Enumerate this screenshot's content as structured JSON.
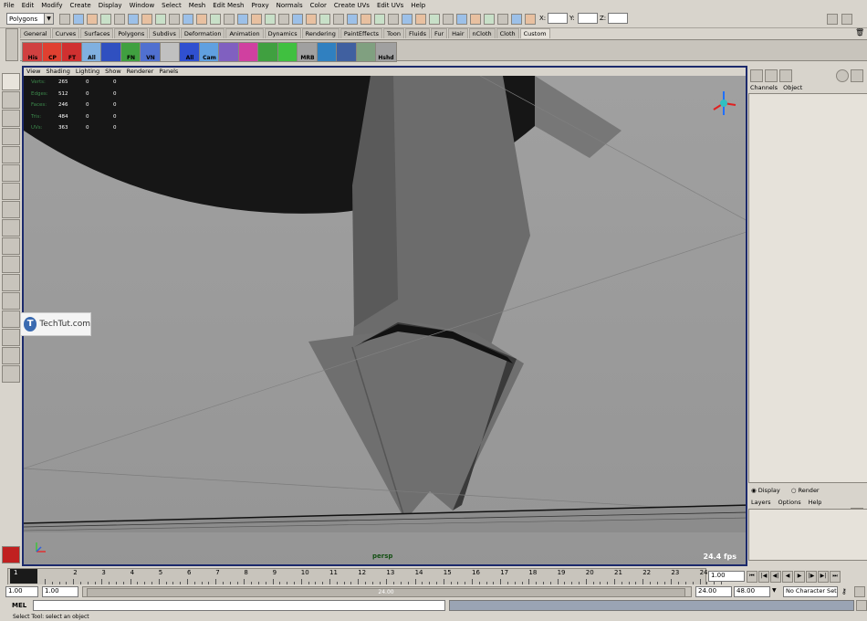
{
  "menu": [
    "File",
    "Edit",
    "Modify",
    "Create",
    "Display",
    "Window",
    "Select",
    "Mesh",
    "Edit Mesh",
    "Proxy",
    "Normals",
    "Color",
    "Create UVs",
    "Edit UVs",
    "Help"
  ],
  "mode_selector": "Polygons",
  "xyz": {
    "x": "X:",
    "y": "Y:",
    "z": "Z:"
  },
  "shelf_tabs": [
    "General",
    "Curves",
    "Surfaces",
    "Polygons",
    "Subdivs",
    "Deformation",
    "Animation",
    "Dynamics",
    "Rendering",
    "PaintEffects",
    "Toon",
    "Fluids",
    "Fur",
    "Hair",
    "nCloth",
    "Cloth",
    "Custom"
  ],
  "active_shelf_tab": "Custom",
  "shelf_buttons": [
    "His",
    "CP",
    "FT",
    "All",
    "",
    "FN",
    "VN",
    "",
    "All",
    "Cam",
    "",
    "",
    "",
    "",
    "MRB",
    "",
    "",
    "",
    "Hshd"
  ],
  "panel_menu": [
    "View",
    "Shading",
    "Lighting",
    "Show",
    "Renderer",
    "Panels"
  ],
  "hud": [
    {
      "k": "Verts:",
      "a": "265",
      "b": "0",
      "c": "0"
    },
    {
      "k": "Edges:",
      "a": "512",
      "b": "0",
      "c": "0"
    },
    {
      "k": "Faces:",
      "a": "246",
      "b": "0",
      "c": "0"
    },
    {
      "k": "Tris:",
      "a": "484",
      "b": "0",
      "c": "0"
    },
    {
      "k": "UVs:",
      "a": "363",
      "b": "0",
      "c": "0"
    }
  ],
  "camera": "persp",
  "fps": "24.4 fps",
  "watermark": "TechTut.com",
  "channel_tabs": [
    "Channels",
    "Object"
  ],
  "layer_modes": [
    "Display",
    "Render"
  ],
  "layer_menu": [
    "Layers",
    "Options",
    "Help"
  ],
  "timeline_ticks": [
    "1",
    "2",
    "3",
    "4",
    "5",
    "6",
    "7",
    "8",
    "9",
    "10",
    "11",
    "12",
    "13",
    "14",
    "15",
    "16",
    "17",
    "18",
    "19",
    "20",
    "21",
    "22",
    "23",
    "24"
  ],
  "current_frame": "1.00",
  "range": {
    "start": "1.00",
    "inner_start": "1.00",
    "range_label": "24.00",
    "end": "24.00",
    "end2": "48.00"
  },
  "character_set": "No Character Set",
  "mel_label": "MEL",
  "help_line": "Select Tool: select an object"
}
